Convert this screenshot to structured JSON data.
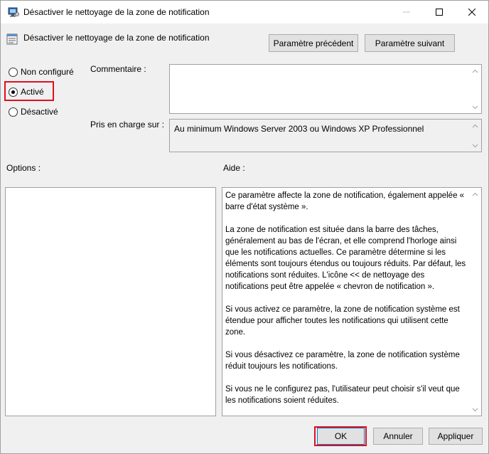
{
  "window": {
    "title": "Désactiver le nettoyage de la zone de notification"
  },
  "header": {
    "policy_title": "Désactiver le nettoyage de la zone de notification",
    "prev_button": "Paramètre précédent",
    "next_button": "Paramètre suivant"
  },
  "state": {
    "options": [
      {
        "label": "Non configuré",
        "checked": false
      },
      {
        "label": "Activé",
        "checked": true
      },
      {
        "label": "Désactivé",
        "checked": false
      }
    ]
  },
  "labels": {
    "comment": "Commentaire :",
    "supported_on": "Pris en charge sur :",
    "options": "Options :",
    "help": "Aide :"
  },
  "comment_value": "",
  "supported_value": "Au minimum Windows Server 2003 ou Windows XP Professionnel",
  "help_paragraphs": [
    "Ce paramètre affecte la zone de notification, également appelée « barre d'état système ».",
    "La zone de notification est située dans la barre des tâches, généralement au bas de l'écran, et elle comprend l'horloge ainsi que les notifications actuelles. Ce paramètre détermine si les éléments sont toujours étendus ou toujours réduits. Par défaut, les notifications sont réduites. L'icône << de nettoyage des notifications peut être appelée « chevron de notification ».",
    "Si vous activez ce paramètre, la zone de notification système est étendue pour afficher toutes les notifications qui utilisent cette zone.",
    "Si vous désactivez ce paramètre, la zone de notification système réduit toujours les notifications.",
    "Si vous ne le configurez pas, l'utilisateur peut choisir s'il veut que les notifications soient réduites."
  ],
  "footer": {
    "ok": "OK",
    "cancel": "Annuler",
    "apply": "Appliquer"
  },
  "colors": {
    "highlight": "#e0101c",
    "accent": "#0078d7"
  }
}
